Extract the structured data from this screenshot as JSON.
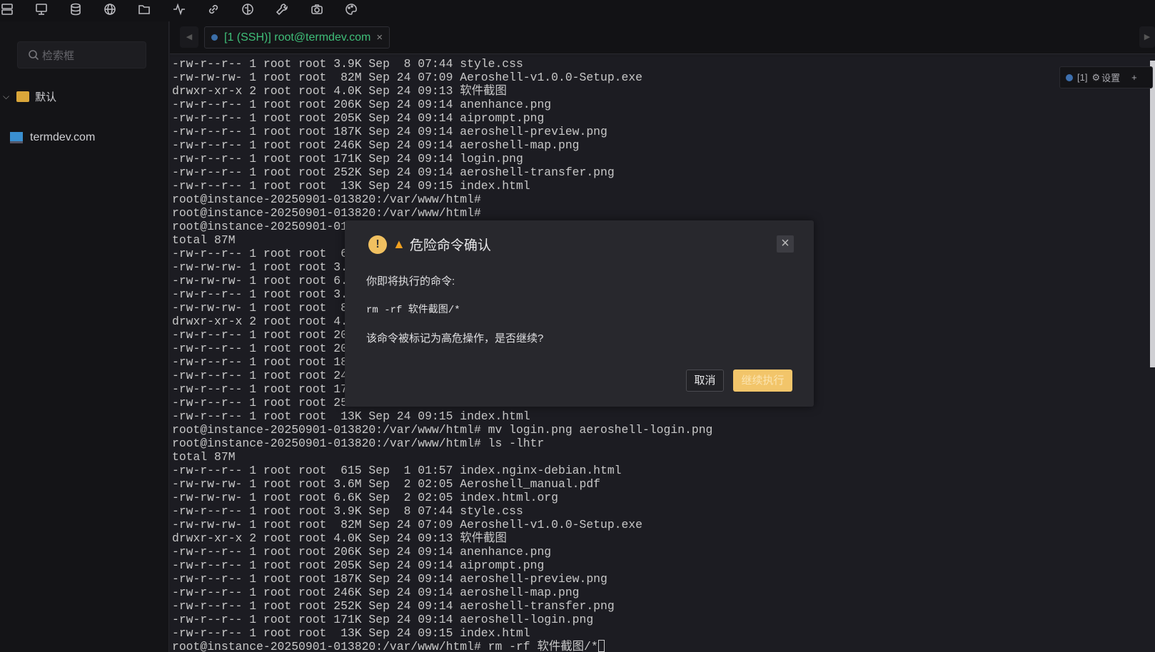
{
  "toolbar": {
    "icons": [
      "server-icon",
      "monitor-icon",
      "database-icon",
      "globe-icon",
      "folder-open-icon",
      "activity-icon",
      "link-icon",
      "brain-icon",
      "wrench-icon",
      "camera-icon",
      "palette-icon"
    ]
  },
  "sidebar": {
    "search_placeholder": "检索框",
    "group": "默认",
    "host": "termdev.com"
  },
  "tab": {
    "label": "[1 (SSH)] root@termdev.com",
    "close": "×"
  },
  "session_pill": {
    "label": "[1]",
    "settings": "设置",
    "add": "+"
  },
  "terminal": {
    "lines": [
      "-rw-r--r-- 1 root root 3.9K Sep  8 07:44 style.css",
      "-rw-rw-rw- 1 root root  82M Sep 24 07:09 Aeroshell-v1.0.0-Setup.exe",
      "drwxr-xr-x 2 root root 4.0K Sep 24 09:13 软件截图",
      "-rw-r--r-- 1 root root 206K Sep 24 09:14 anenhance.png",
      "-rw-r--r-- 1 root root 205K Sep 24 09:14 aiprompt.png",
      "-rw-r--r-- 1 root root 187K Sep 24 09:14 aeroshell-preview.png",
      "-rw-r--r-- 1 root root 246K Sep 24 09:14 aeroshell-map.png",
      "-rw-r--r-- 1 root root 171K Sep 24 09:14 login.png",
      "-rw-r--r-- 1 root root 252K Sep 24 09:14 aeroshell-transfer.png",
      "-rw-r--r-- 1 root root  13K Sep 24 09:15 index.html",
      "root@instance-20250901-013820:/var/www/html#",
      "root@instance-20250901-013820:/var/www/html#",
      "root@instance-20250901-01",
      "total 87M",
      "-rw-r--r-- 1 root root  6",
      "-rw-rw-rw- 1 root root 3.",
      "-rw-rw-rw- 1 root root 6.",
      "-rw-r--r-- 1 root root 3.",
      "-rw-rw-rw- 1 root root  8",
      "drwxr-xr-x 2 root root 4.",
      "-rw-r--r-- 1 root root 20",
      "-rw-r--r-- 1 root root 20",
      "-rw-r--r-- 1 root root 18",
      "-rw-r--r-- 1 root root 24",
      "-rw-r--r-- 1 root root 17",
      "-rw-r--r-- 1 root root 25",
      "-rw-r--r-- 1 root root  13K Sep 24 09:15 index.html",
      "root@instance-20250901-013820:/var/www/html# mv login.png aeroshell-login.png",
      "root@instance-20250901-013820:/var/www/html# ls -lhtr",
      "total 87M",
      "-rw-r--r-- 1 root root  615 Sep  1 01:57 index.nginx-debian.html",
      "-rw-rw-rw- 1 root root 3.6M Sep  2 02:05 Aeroshell_manual.pdf",
      "-rw-rw-rw- 1 root root 6.6K Sep  2 02:05 index.html.org",
      "-rw-r--r-- 1 root root 3.9K Sep  8 07:44 style.css",
      "-rw-rw-rw- 1 root root  82M Sep 24 07:09 Aeroshell-v1.0.0-Setup.exe",
      "drwxr-xr-x 2 root root 4.0K Sep 24 09:13 软件截图",
      "-rw-r--r-- 1 root root 206K Sep 24 09:14 anenhance.png",
      "-rw-r--r-- 1 root root 205K Sep 24 09:14 aiprompt.png",
      "-rw-r--r-- 1 root root 187K Sep 24 09:14 aeroshell-preview.png",
      "-rw-r--r-- 1 root root 246K Sep 24 09:14 aeroshell-map.png",
      "-rw-r--r-- 1 root root 252K Sep 24 09:14 aeroshell-transfer.png",
      "-rw-r--r-- 1 root root 171K Sep 24 09:14 aeroshell-login.png",
      "-rw-r--r-- 1 root root  13K Sep 24 09:15 index.html"
    ],
    "prompt_line": "root@instance-20250901-013820:/var/www/html# rm -rf 软件截图/*"
  },
  "dialog": {
    "title": "危险命令确认",
    "intro": "你即将执行的命令:",
    "command": "rm -rf 软件截图/*",
    "question": "该命令被标记为高危操作，是否继续?",
    "cancel": "取消",
    "confirm": "继续执行",
    "close": "×"
  },
  "colors": {
    "accent": "#f2c56a",
    "tab_text": "#3fbf79",
    "warning": "#f0a020"
  }
}
